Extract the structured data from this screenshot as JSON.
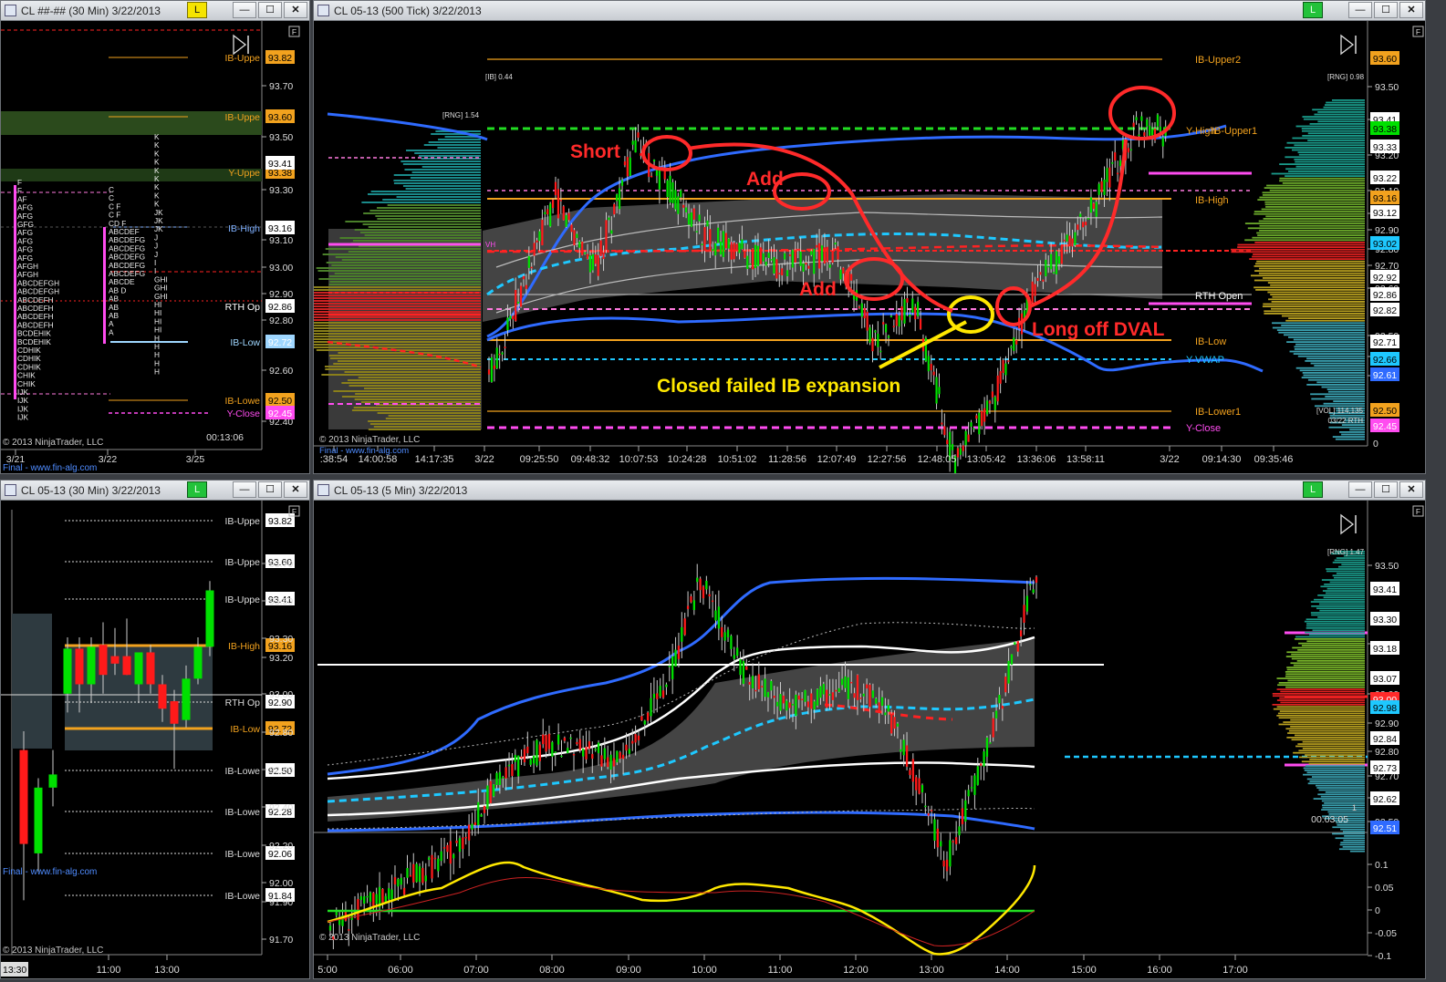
{
  "windows": {
    "w1": {
      "title": "CL ##-## (30 Min)  3/22/2013",
      "btn_l": "L",
      "btn_min": "—",
      "btn_max": "☐",
      "btn_close": "✕"
    },
    "w2": {
      "title": "CL 05-13 (500 Tick)  3/22/2013",
      "btn_l": "L",
      "btn_min": "—",
      "btn_max": "☐",
      "btn_close": "✕"
    },
    "w3": {
      "title": "CL 05-13 (30 Min)  3/22/2013",
      "btn_l": "L",
      "btn_min": "—",
      "btn_max": "☐",
      "btn_close": "✕"
    },
    "w4": {
      "title": "CL 05-13 (5 Min)  3/22/2013",
      "btn_l": "L",
      "btn_min": "—",
      "btn_max": "☐",
      "btn_close": "✕"
    }
  },
  "icons": {
    "pan": "pan-right-icon",
    "filter": "F"
  },
  "copyright": "© 2013 NinjaTrader, LLC",
  "watermark": "Final - www.fin-alg.com",
  "colors": {
    "up": "#00e000",
    "down": "#ff1a1a",
    "red_annot": "#ff2a2a",
    "yellow_annot": "#ffe800",
    "band": "#2f6bff",
    "vwap": "#1ec8ff",
    "ib_level": "#f2a21e",
    "pink_level": "#ff4cf0"
  },
  "chart_data": [
    {
      "type": "candlestick",
      "name": "CL ##-## (30 Min) market profile",
      "y_ticks": [
        "93.70",
        "93.50",
        "93.30",
        "93.10",
        "93.00",
        "92.90",
        "92.80",
        "92.60",
        "92.40"
      ],
      "x_ticks": [
        "3/21",
        "3/22",
        "3/25"
      ],
      "level_labels": [
        {
          "text": "IB-Uppe",
          "value": "93.82",
          "color": "#f2a21e"
        },
        {
          "text": "IB-Uppe",
          "value": "93.60",
          "color": "#f2a21e"
        },
        {
          "text": "Y-Uppe",
          "value": "93.38",
          "color": "#f2a21e"
        },
        {
          "text": "IB-High",
          "value": "93.16",
          "color": "#7fb0ff"
        },
        {
          "text": "RTH Op",
          "value": "92.86",
          "color": "#ffffff"
        },
        {
          "text": "IB-Low",
          "value": "92.72",
          "color": "#9fd7ff"
        },
        {
          "text": "IB-Lowe",
          "value": "92.50",
          "color": "#f2a21e"
        },
        {
          "text": "Y-Close",
          "value": "92.45",
          "color": "#ff4cf0"
        }
      ],
      "extra_price_tags": [
        "93.41"
      ],
      "timer": "00:13:06",
      "profile_columns": {
        "col1": [
          "F",
          "F",
          "AF",
          "AFG",
          "AFG",
          "GFG",
          "AFG",
          "AFG",
          "AFG",
          "AFG",
          "AFGH",
          "AFGH",
          "ABCDEFGH",
          "ABCDEFGH",
          "ABCDEFH",
          "ABCDEFH",
          "ABCDEFH",
          "ABCDEFH",
          "BCDEHIK",
          "BCDEHIK",
          "CDHIK",
          "CDHIK",
          "CDHIK",
          "CHIK",
          "CHIK",
          "IJK",
          "IJK",
          "IJK",
          "IJK"
        ],
        "col2": [
          "C",
          "C",
          "C F",
          "C F",
          "CD F",
          "ABCDEF",
          "ABCDEFG",
          "ABCDEFG",
          "ABCDEFG",
          "ABCDEFG",
          "ABCDEFG",
          "ABCDE",
          "AB D",
          "AB",
          "AB",
          "AB",
          "A",
          "A"
        ],
        "col3": [
          "K",
          "K",
          "K",
          "K",
          "K",
          "K",
          "K",
          "K",
          "K",
          "JK",
          "JK",
          "JK",
          "J",
          "J",
          "J",
          "I",
          "I",
          "GHI",
          "GHI",
          "GHI",
          "HI",
          "HI",
          "HI",
          "HI",
          "H",
          "H",
          "H",
          "H",
          "H"
        ]
      }
    },
    {
      "type": "candlestick",
      "name": "CL 05-13 (500 Tick)",
      "y_ticks": [
        "93.50",
        "93.30",
        "93.20",
        "93.10",
        "93.00",
        "92.90",
        "92.80",
        "92.70",
        "92.60",
        "92.50",
        "92.40",
        "92.30"
      ],
      "x_ticks": [
        ":38:54",
        "14:00:58",
        "14:17:35",
        "3/22",
        "09:25:50",
        "09:48:32",
        "10:07:53",
        "10:24:28",
        "10:51:02",
        "11:28:56",
        "12:07:49",
        "12:27:56",
        "12:48:05",
        "13:05:42",
        "13:36:06",
        "13:58:11",
        "3/22",
        "09:14:30",
        "09:35:46"
      ],
      "right_axis_zero": "0",
      "price_tags": [
        {
          "value": "93.60",
          "color": "#f2a21e"
        },
        {
          "value": "93.41",
          "color": "#ffffff"
        },
        {
          "value": "93.38",
          "color": "#00e000"
        },
        {
          "value": "93.33",
          "color": "#ffffff"
        },
        {
          "value": "93.22",
          "color": "#ffffff"
        },
        {
          "value": "93.16",
          "color": "#f2a21e"
        },
        {
          "value": "93.12",
          "color": "#ffffff"
        },
        {
          "value": "93.02",
          "color": "#1ec8ff"
        },
        {
          "value": "92.92",
          "color": "#ffffff"
        },
        {
          "value": "92.86",
          "color": "#ffffff"
        },
        {
          "value": "92.82",
          "color": "#ffffff"
        },
        {
          "value": "92.71",
          "color": "#ffffff"
        },
        {
          "value": "92.66",
          "color": "#1ec8ff"
        },
        {
          "value": "92.61",
          "color": "#2f6bff"
        },
        {
          "value": "92.50",
          "color": "#f2a21e"
        },
        {
          "value": "92.45",
          "color": "#ff4cf0"
        }
      ],
      "level_labels": [
        {
          "text": "IB-Upper2",
          "color": "#f2a21e"
        },
        {
          "text": "Y-High",
          "color": "#f2a21e"
        },
        {
          "text": "IB-Upper1",
          "color": "#f2a21e"
        },
        {
          "text": "IB-High",
          "color": "#f2a21e"
        },
        {
          "text": "RTH Open",
          "color": "#ffffff"
        },
        {
          "text": "IB-Low",
          "color": "#f2a21e"
        },
        {
          "text": "Y-VWAP",
          "color": "#1ec8ff"
        },
        {
          "text": "IB-Lower1",
          "color": "#f2a21e"
        },
        {
          "text": "Y-Close",
          "color": "#ff4cf0"
        }
      ],
      "small_labels": {
        "ib": "[IB] 0.44",
        "rng": "[RNG] 1.54",
        "rng_right": "[RNG] 0.98",
        "vh": "VH",
        "vol": "[VOL] 114,135",
        "vol_date": "03/22 RTH"
      },
      "annotations": [
        {
          "text": "Short",
          "color": "#ff2a2a"
        },
        {
          "text": "Add",
          "color": "#ff2a2a"
        },
        {
          "text": "Add",
          "color": "#ff2a2a"
        },
        {
          "text": "Long off DVAL",
          "color": "#ff2a2a"
        },
        {
          "text": "Closed failed IB expansion",
          "color": "#ffe800"
        }
      ]
    },
    {
      "type": "candlestick",
      "name": "CL 05-13 (30 Min)",
      "y_ticks": [
        "93.70",
        "93.50",
        "93.30",
        "93.20",
        "93.00",
        "92.80",
        "92.60",
        "92.40",
        "92.20",
        "92.00",
        "91.90",
        "91.70"
      ],
      "x_ticks": [
        "11:00",
        "13:00"
      ],
      "corner_time": "13:30",
      "level_labels": [
        {
          "text": "IB-Uppe",
          "value": "93.82"
        },
        {
          "text": "IB-Uppe",
          "value": "93.60"
        },
        {
          "text": "IB-Uppe",
          "value": "93.41"
        },
        {
          "text": "IB-High",
          "value": "93.16"
        },
        {
          "text": "RTH Op",
          "value": "92.90"
        },
        {
          "text": "IB-Low",
          "value": "92.72"
        },
        {
          "text": "IB-Lowe",
          "value": "92.50"
        },
        {
          "text": "IB-Lowe",
          "value": "92.28"
        },
        {
          "text": "IB-Lowe",
          "value": "92.06"
        },
        {
          "text": "IB-Lowe",
          "value": "91.84"
        }
      ],
      "candles": [
        {
          "o": 92.6,
          "h": 92.7,
          "l": 91.8,
          "c": 92.1
        },
        {
          "o": 92.05,
          "h": 92.45,
          "l": 91.95,
          "c": 92.4
        },
        {
          "o": 92.4,
          "h": 92.6,
          "l": 92.3,
          "c": 92.47
        },
        {
          "o": 92.9,
          "h": 93.2,
          "l": 92.8,
          "c": 93.14
        },
        {
          "o": 93.14,
          "h": 93.2,
          "l": 92.8,
          "c": 92.95
        },
        {
          "o": 92.95,
          "h": 93.2,
          "l": 92.85,
          "c": 93.15
        },
        {
          "o": 93.16,
          "h": 93.28,
          "l": 92.9,
          "c": 93.0
        },
        {
          "o": 93.1,
          "h": 93.25,
          "l": 93.0,
          "c": 93.06
        },
        {
          "o": 93.1,
          "h": 93.3,
          "l": 93.0,
          "c": 93.0
        },
        {
          "o": 92.95,
          "h": 93.05,
          "l": 92.85,
          "c": 93.12
        },
        {
          "o": 93.12,
          "h": 93.16,
          "l": 92.9,
          "c": 92.95
        },
        {
          "o": 92.95,
          "h": 93.0,
          "l": 92.75,
          "c": 92.82
        },
        {
          "o": 92.86,
          "h": 92.92,
          "l": 92.5,
          "c": 92.74
        },
        {
          "o": 92.76,
          "h": 93.05,
          "l": 92.72,
          "c": 92.98
        },
        {
          "o": 92.98,
          "h": 93.2,
          "l": 92.95,
          "c": 93.15
        },
        {
          "o": 93.15,
          "h": 93.5,
          "l": 93.1,
          "c": 93.45
        }
      ]
    },
    {
      "type": "candlestick",
      "name": "CL 05-13 (5 Min)",
      "y_ticks": [
        "93.50",
        "93.20",
        "93.00",
        "92.90",
        "92.80",
        "92.70",
        "92.60",
        "92.50"
      ],
      "x_ticks": [
        "5:00",
        "06:00",
        "07:00",
        "08:00",
        "09:00",
        "10:00",
        "11:00",
        "12:00",
        "13:00",
        "14:00",
        "15:00",
        "16:00",
        "17:00"
      ],
      "price_tags": [
        {
          "value": "93.41",
          "color": "#ffffff"
        },
        {
          "value": "93.30",
          "color": "#ffffff"
        },
        {
          "value": "93.18",
          "color": "#ffffff"
        },
        {
          "value": "93.07",
          "color": "#ffffff"
        },
        {
          "value": "93.00",
          "color": "#ff2a2a"
        },
        {
          "value": "92.98",
          "color": "#1ec8ff"
        },
        {
          "value": "92.84",
          "color": "#ffffff"
        },
        {
          "value": "92.73",
          "color": "#ffffff"
        },
        {
          "value": "92.62",
          "color": "#ffffff"
        },
        {
          "value": "92.51",
          "color": "#2f6bff"
        }
      ],
      "small_labels": {
        "rng": "[RNG] 1.47",
        "timer": "00:03:05",
        "vol_one": "1"
      },
      "oscillator": {
        "y_ticks": [
          "0.1",
          "0.05",
          "0",
          "-0.05",
          "-0.1"
        ]
      }
    }
  ]
}
